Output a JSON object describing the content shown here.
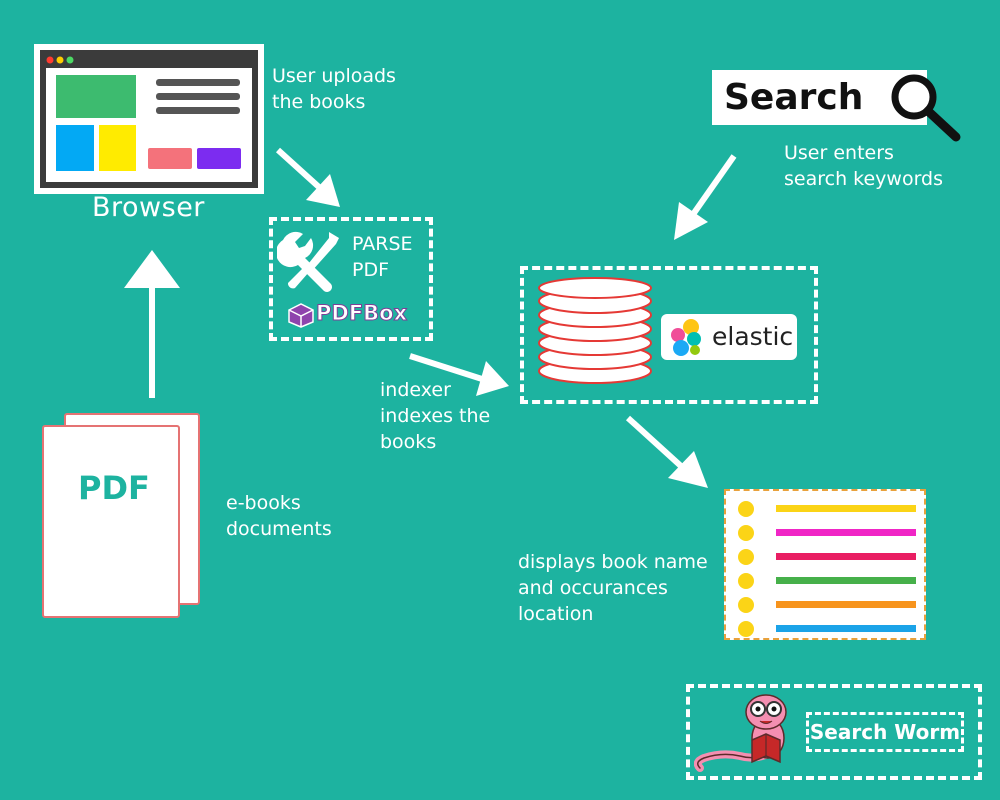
{
  "browser": {
    "label": "Browser"
  },
  "steps": {
    "upload": "User uploads\nthe books",
    "parse": "PARSE\nPDF",
    "pdfbox": "PDFBox",
    "search_label": "Search",
    "search_caption": "User enters\nsearch keywords",
    "elastic": "elastic",
    "indexer": "indexer\nindexes the\nbooks",
    "pdf": "PDF",
    "ebooks": "e-books\ndocuments",
    "results": "displays book name\nand occurances\nlocation",
    "brand": "Search Worm"
  },
  "colors": {
    "background": "#1db3a0",
    "browser_green": "#3dbb6f",
    "browser_blue": "#03a9f4",
    "browser_yellow": "#ffeb00",
    "browser_pink": "#f4727b",
    "browser_purple": "#7c2cf0",
    "db_red": "#e53935",
    "list_dot": "#fbd417",
    "list_border": "#e8a13c"
  },
  "result_lines": [
    "#fbd417",
    "#f026c6",
    "#e91e63",
    "#46b04a",
    "#f7941d",
    "#1ba3e8"
  ]
}
